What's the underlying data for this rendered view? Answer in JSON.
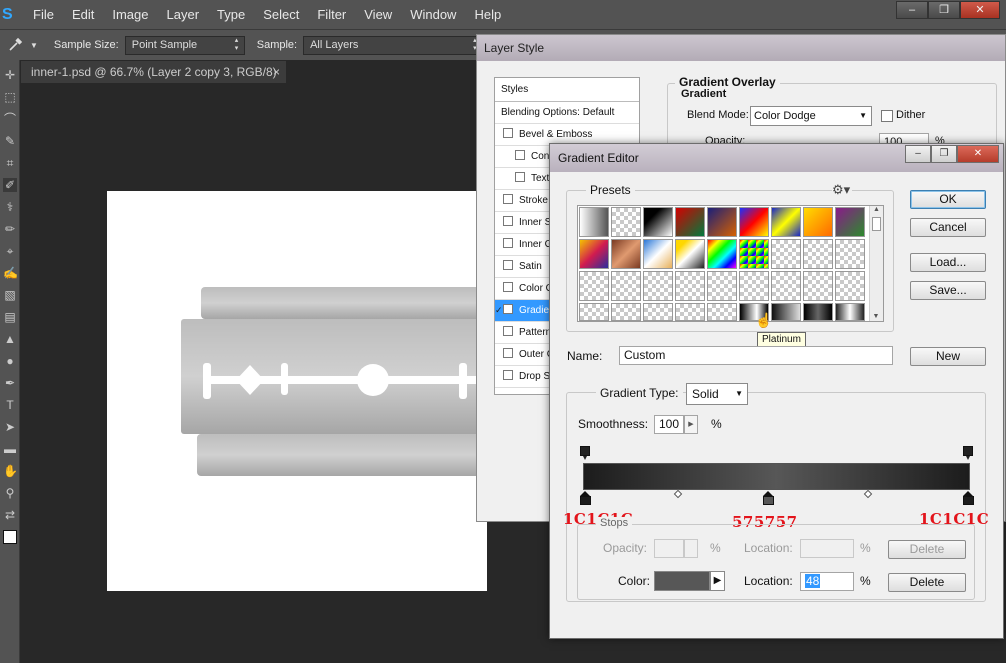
{
  "app": {
    "logo": "S",
    "menu": [
      "File",
      "Edit",
      "Image",
      "Layer",
      "Type",
      "Select",
      "Filter",
      "View",
      "Window",
      "Help"
    ],
    "window_controls": {
      "minimize": "–",
      "restore": "❐",
      "close": "✕"
    }
  },
  "options_bar": {
    "tool_icon": "eyedropper-icon",
    "sample_size_label": "Sample Size:",
    "sample_size_value": "Point Sample",
    "sample_label": "Sample:",
    "sample_value": "All Layers"
  },
  "document": {
    "tab_title": "inner-1.psd @ 66.7% (Layer 2 copy 3, RGB/8)",
    "tab_close": "×"
  },
  "layer_style": {
    "title": "Layer Style",
    "styles_header": "Styles",
    "blending": "Blending Options: Default",
    "items": [
      {
        "label": "Bevel & Emboss",
        "checked": false,
        "sub": false
      },
      {
        "label": "Contour",
        "checked": false,
        "sub": true
      },
      {
        "label": "Texture",
        "checked": false,
        "sub": true
      },
      {
        "label": "Stroke",
        "checked": false,
        "sub": false
      },
      {
        "label": "Inner Shadow",
        "checked": false,
        "sub": false
      },
      {
        "label": "Inner Glow",
        "checked": false,
        "sub": false
      },
      {
        "label": "Satin",
        "checked": false,
        "sub": false
      },
      {
        "label": "Color Overlay",
        "checked": false,
        "sub": false
      },
      {
        "label": "Gradient Overlay",
        "checked": true,
        "sub": false,
        "active": true
      },
      {
        "label": "Pattern Overlay",
        "checked": false,
        "sub": false
      },
      {
        "label": "Outer Glow",
        "checked": false,
        "sub": false
      },
      {
        "label": "Drop Shadow",
        "checked": false,
        "sub": false
      }
    ],
    "group_title": "Gradient Overlay",
    "sub_title": "Gradient",
    "blend_mode_label": "Blend Mode:",
    "blend_mode_value": "Color Dodge",
    "dither_label": "Dither",
    "opacity_label": "Opacity:",
    "opacity_value": "100",
    "opacity_unit": "%"
  },
  "gradient_editor": {
    "title": "Gradient Editor",
    "presets_label": "Presets",
    "gear_icon": "gear-icon",
    "ok": "OK",
    "cancel": "Cancel",
    "load": "Load...",
    "save": "Save...",
    "name_label": "Name:",
    "name_value": "Custom",
    "new_button": "New",
    "gradient_type_label": "Gradient Type:",
    "gradient_type_value": "Solid",
    "smoothness_label": "Smoothness:",
    "smoothness_value": "100",
    "smoothness_unit": "%",
    "tooltip": "Platinum",
    "stops_label": "Stops",
    "opacity_label": "Opacity:",
    "opacity_unit": "%",
    "location_label": "Location:",
    "location_unit": "%",
    "delete_label": "Delete",
    "color_label": "Color:",
    "color_location_value": "48",
    "selected_color": "#575757",
    "gradient_colors": [
      "#1c1c1c",
      "#575757",
      "#1c1c1c"
    ],
    "annotations": [
      "1C1C1C",
      "575757",
      "1C1C1C"
    ]
  }
}
